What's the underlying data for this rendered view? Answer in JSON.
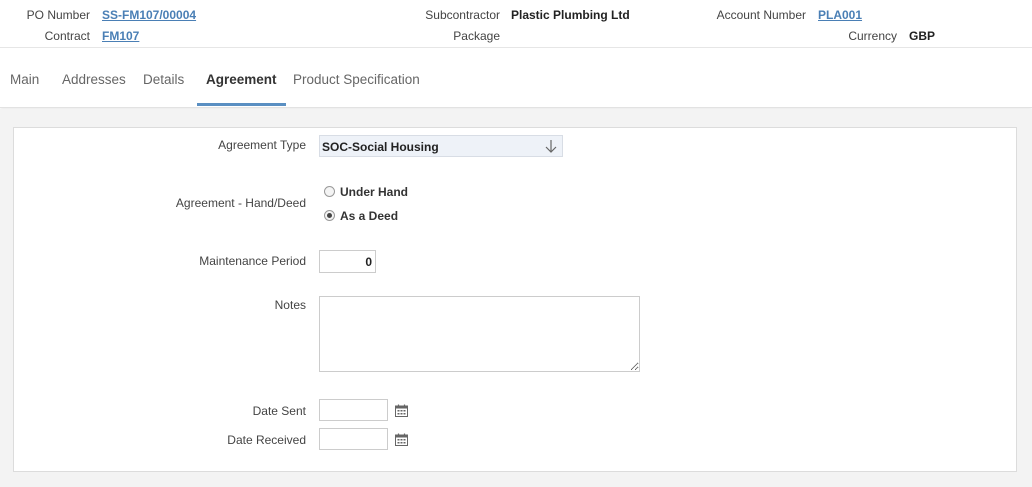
{
  "header": {
    "po_number_label": "PO Number",
    "po_number_value": "SS-FM107/00004",
    "contract_label": "Contract",
    "contract_value": "FM107",
    "subcontractor_label": "Subcontractor",
    "subcontractor_value": "Plastic Plumbing Ltd",
    "package_label": "Package",
    "account_number_label": "Account Number",
    "account_number_value": "PLA001",
    "currency_label": "Currency",
    "currency_value": "GBP"
  },
  "tabs": [
    {
      "label": "Main"
    },
    {
      "label": "Addresses"
    },
    {
      "label": "Details"
    },
    {
      "label": "Agreement",
      "active": true
    },
    {
      "label": "Product Specification"
    }
  ],
  "form": {
    "agreement_type_label": "Agreement Type",
    "agreement_type_value": "SOC-Social Housing",
    "hand_deed_label": "Agreement - Hand/Deed",
    "options": [
      {
        "label": "Under Hand",
        "checked": false
      },
      {
        "label": "As a Deed",
        "checked": true
      }
    ],
    "maintenance_label": "Maintenance Period",
    "maintenance_value": "0",
    "notes_label": "Notes",
    "notes_value": "",
    "date_sent_label": "Date Sent",
    "date_sent_value": "",
    "date_received_label": "Date Received",
    "date_received_value": ""
  },
  "icons": {
    "dropdown_arrow": "arrow-down-icon",
    "calendar": "calendar-icon"
  },
  "colors": {
    "link": "#4a7fb5",
    "active_tab_underline": "#5a8fc2",
    "select_bg": "#eef2f8"
  }
}
